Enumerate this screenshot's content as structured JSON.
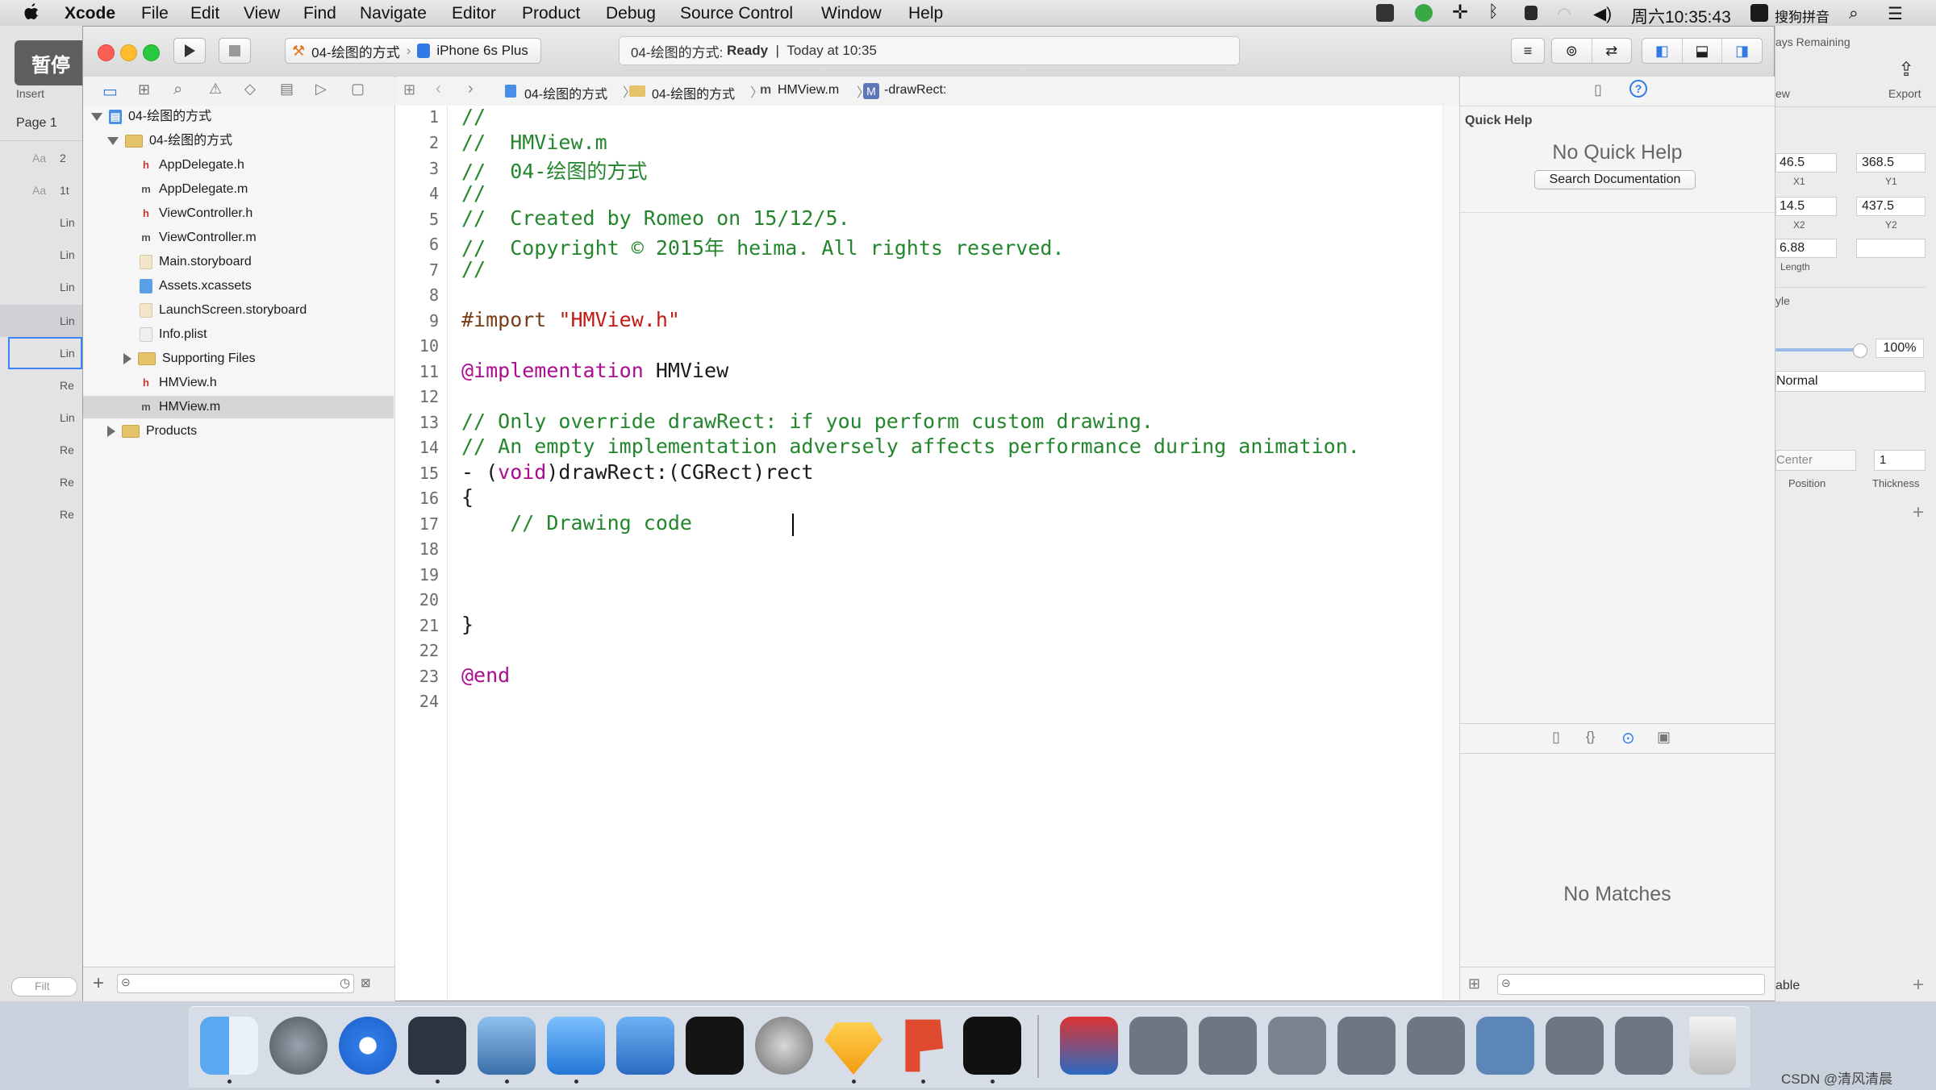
{
  "menubar": {
    "items": [
      "Xcode",
      "File",
      "Edit",
      "View",
      "Find",
      "Navigate",
      "Editor",
      "Product",
      "Debug",
      "Source Control",
      "Window",
      "Help"
    ],
    "clock": "周六10:35:43",
    "input_method": "搜狗拼音"
  },
  "overlay": {
    "pause_label": "暂停"
  },
  "toolbar": {
    "scheme_project": "04-绘图的方式",
    "scheme_device": "iPhone 6s Plus",
    "activity_project": "04-绘图的方式:",
    "activity_status": "Ready",
    "activity_sep": "|",
    "activity_time": "Today at 10:35"
  },
  "jumpbar": {
    "crumbs": [
      "04-绘图的方式",
      "04-绘图的方式",
      "HMView.m",
      "-drawRect:"
    ]
  },
  "navigator": {
    "rows": [
      {
        "label": "04-绘图的方式",
        "type": "project"
      },
      {
        "label": "04-绘图的方式",
        "type": "folder"
      },
      {
        "label": "AppDelegate.h",
        "type": "h"
      },
      {
        "label": "AppDelegate.m",
        "type": "m"
      },
      {
        "label": "ViewController.h",
        "type": "h"
      },
      {
        "label": "ViewController.m",
        "type": "m"
      },
      {
        "label": "Main.storyboard",
        "type": "storyboard"
      },
      {
        "label": "Assets.xcassets",
        "type": "assets"
      },
      {
        "label": "LaunchScreen.storyboard",
        "type": "storyboard"
      },
      {
        "label": "Info.plist",
        "type": "plist"
      },
      {
        "label": "Supporting Files",
        "type": "folder"
      },
      {
        "label": "HMView.h",
        "type": "h"
      },
      {
        "label": "HMView.m",
        "type": "m"
      },
      {
        "label": "Products",
        "type": "folder"
      }
    ]
  },
  "editor": {
    "line_numbers": [
      "1",
      "2",
      "3",
      "4",
      "5",
      "6",
      "7",
      "8",
      "9",
      "10",
      "11",
      "12",
      "13",
      "14",
      "15",
      "16",
      "17",
      "18",
      "19",
      "20",
      "21",
      "22",
      "23",
      "24"
    ],
    "l1": "//",
    "l2": "//  HMView.m",
    "l3": "//  04-绘图的方式",
    "l4": "//",
    "l5": "//  Created by Romeo on 15/12/5.",
    "l6": "//  Copyright © 2015年 heima. All rights reserved.",
    "l7": "//",
    "l9_directive": "#import ",
    "l9_string": "\"HMView.h\"",
    "l11_kw": "@implementation",
    "l11_name": " HMView",
    "l13": "// Only override drawRect: if you perform custom drawing.",
    "l14": "// An empty implementation adversely affects performance during animation.",
    "l15_a": "- (",
    "l15_kw": "void",
    "l15_b": ")drawRect:(CGRect)rect",
    "l16": "{",
    "l17": "    // Drawing code",
    "l21": "}",
    "l23": "@end"
  },
  "inspector": {
    "quick_help_title": "Quick Help",
    "no_quick_help": "No Quick Help",
    "search_documentation": "Search Documentation",
    "no_matches": "No Matches"
  },
  "sketch": {
    "insert": "Insert",
    "page": "Page 1",
    "layers": [
      "2",
      "1t",
      "Lin",
      "Lin",
      "Lin",
      "Lin",
      "Lin",
      "Re",
      "Lin",
      "Re",
      "Re",
      "Re"
    ],
    "layer_prefix": [
      "Aa",
      "Aa"
    ],
    "filter": "Filt",
    "trial": "ays Remaining",
    "export": "Export",
    "view": "ew",
    "x1": "46.5",
    "y1": "368.5",
    "x1_label": "X1",
    "y1_label": "Y1",
    "x2": "14.5",
    "y2": "437.5",
    "x2_label": "X2",
    "y2_label": "Y2",
    "length": "6.88",
    "length_label": "Length",
    "style": "yle",
    "opacity": "100%",
    "blend": "Normal",
    "position": "Center",
    "thickness": "1",
    "position_label": "Position",
    "thickness_label": "Thickness",
    "table": "able"
  },
  "watermark": "CSDN @清风清晨",
  "colors": {
    "comment": "#23862d",
    "keyword": "#ab0d90",
    "string": "#c41a16",
    "accent": "#2f7ae5"
  }
}
